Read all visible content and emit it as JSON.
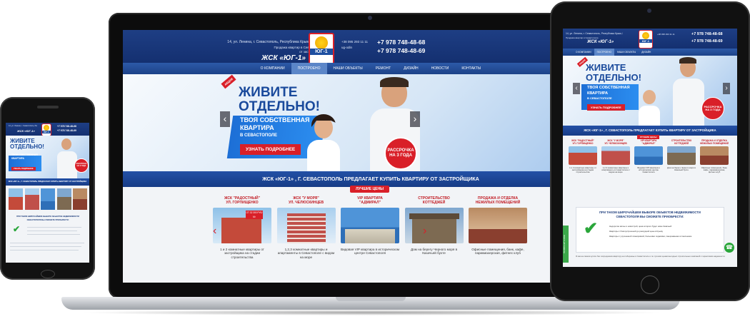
{
  "site": {
    "address": "14, ул. Ленина, г. Севастополь, Республика Крым, Россия",
    "tagline_1": "Продажа квартир в Севастополе",
    "tagline_2": "от застройщика",
    "brand": "ЖСК «ЮГ-1»",
    "logo_text": "ЮГ-1",
    "email_prefix": "+38 095 293 11 11",
    "skype": "ug-odin",
    "phone_1": "+7 978 748-48-68",
    "phone_2": "+7 978 748-48-69"
  },
  "nav": {
    "items": [
      {
        "label": "О компании",
        "active": false
      },
      {
        "label": "Построено",
        "active": true
      },
      {
        "label": "Наши объекты",
        "active": false
      },
      {
        "label": "Ремонт",
        "active": false
      },
      {
        "label": "Дизайн",
        "active": false
      },
      {
        "label": "Новости",
        "active": false
      },
      {
        "label": "Контакты",
        "active": false
      }
    ]
  },
  "hero": {
    "title_1": "ЖИВИТЕ",
    "title_2": "ОТДЕЛЬНО!",
    "sub_1": "ТВОЯ СОБСТВЕННАЯ",
    "sub_2": "КВАРТИРА",
    "sub_3": "В СЕВАСТОПОЛЕ",
    "button": "УЗНАТЬ ПОДРОБНЕЕ",
    "badge_1": "РАССРОЧКА",
    "badge_2": "НА 3 ГОДА",
    "tag": "АКЦИЯ",
    "prev": "‹",
    "next": "›"
  },
  "band": {
    "text": "ЖСК «ЮГ-1» , Г. СЕВАСТОПОЛЬ ПРЕДЛАГАЕТ КУПИТЬ КВАРТИРУ ОТ ЗАСТРОЙЩИКА",
    "ribbon": "ЛУЧШИЕ ЦЕНЫ"
  },
  "cards": [
    {
      "title_1": "ЖСК \"РАДОСТНЫЙ\"",
      "title_2": "УЛ. ГОРПИЩЕНКО",
      "desc": "1 и 2 комнатные квартиры от застройщика на стадии строительства",
      "color": "#c44a3a",
      "sky": "#8fc1e8",
      "tag": "ОТ 32 300 РУБ/М²"
    },
    {
      "title_1": "ЖСК \"У МОРЯ\"",
      "title_2": "УЛ. ЧЕЛЮСКИНЦЕВ",
      "desc": "1,2,3 комнатные квартиры и апартаменты в Севастополе с видом на море",
      "color": "#c0504a",
      "sky": "#a9cfee",
      "tag": ""
    },
    {
      "title_1": "VIP КВАРТИРА",
      "title_2": "\"АДМИРАЛ\"",
      "desc": "Видовая VIP квартира в историческом центре Севастополя",
      "color": "#2e6fb8",
      "sky": "#4f94d8",
      "tag": ""
    },
    {
      "title_1": "СТРОИТЕЛЬСТВО",
      "title_2": "КОТТЕДЖЕЙ",
      "desc": "Дом на берегу Черного моря в Казачьей бухте",
      "color": "#7d6a52",
      "sky": "#7fa7cf",
      "tag": ""
    },
    {
      "title_1": "ПРОДАЖА И ОТДЕЛКА",
      "title_2": "НЕЖИЛЫХ ПОМЕЩЕНИЙ",
      "desc": "Офисные помещения, банк, кафе, парикмахерская, фитнес клуб",
      "color": "#8a3f2f",
      "sky": "#b98a62",
      "tag": ""
    }
  ],
  "features": {
    "heading_1": "ПРИ ТАКОМ ШИРОЧАЙШЕМ ВЫБОРЕ ОБЪЕКТОВ НЕДВИЖИМОСТИ",
    "heading_2": "СЕВАСТОПОЛЯ ВЫ СМОЖЕТЕ ПРИОБРЕСТИ:",
    "check": "✔",
    "lines": [
      "Недорогие жилье и новострой, цена которого будет ниже Казачьей",
      "Квартиры с благоустроенной до рекордной цены в Крыму",
      "Квартиры с улучшенной планировкой, большими лоджиями, панорамными остеклением"
    ],
    "side_tab": "ПОЗВОНИТЬ МНЕ",
    "phone_icon": "phone-icon",
    "note": "Я как на самом купите без посредников квартиру на побережье в Севастополе и по лучшим ценам выгодных строительных компаний с гарантиями надежности."
  },
  "colors": {
    "brand_blue": "#1c4288",
    "accent_red": "#d91f28",
    "check_green": "#2aa63a"
  }
}
